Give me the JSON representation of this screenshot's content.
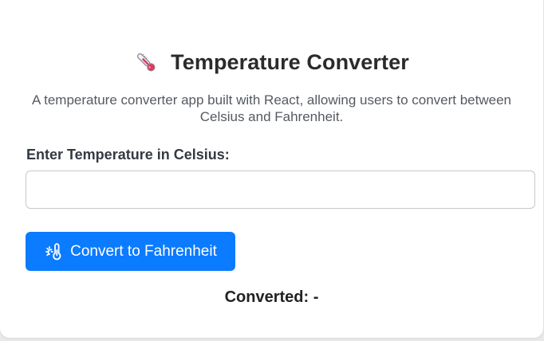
{
  "app": {
    "icon": "thermometer-icon",
    "title": "Temperature Converter",
    "description": "A temperature converter app built with React, allowing users to convert between Celsius and Fahrenheit."
  },
  "form": {
    "label": "Enter Temperature in Celsius:",
    "input_value": "",
    "input_placeholder": ""
  },
  "convert_button": {
    "icon": "sun-thermometer-icon",
    "label": "Convert to Fahrenheit",
    "color": "#0b7bff"
  },
  "result": {
    "prefix": "Converted:",
    "value": "-"
  }
}
